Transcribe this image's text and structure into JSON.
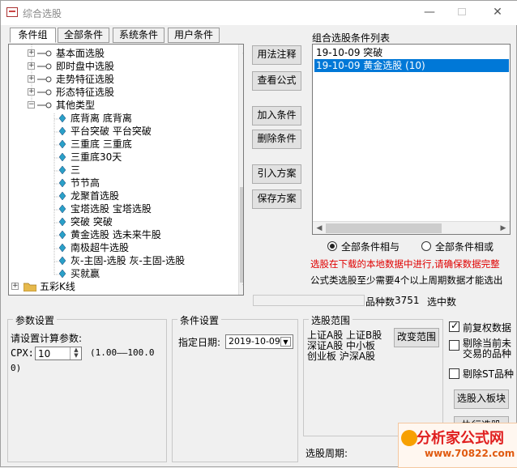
{
  "window": {
    "title": "综合选股"
  },
  "tabs": [
    {
      "label": "条件组"
    },
    {
      "label": "全部条件"
    },
    {
      "label": "系统条件"
    },
    {
      "label": "用户条件"
    }
  ],
  "tree": {
    "categories": [
      {
        "label": "基本面选股"
      },
      {
        "label": "即时盘中选股"
      },
      {
        "label": "走势特征选股"
      },
      {
        "label": "形态特征选股"
      },
      {
        "label": "其他类型"
      }
    ],
    "items": [
      {
        "label": "底背离 底背离"
      },
      {
        "label": "平台突破 平台突破"
      },
      {
        "label": "三重底 三重底"
      },
      {
        "label": "三重底30天"
      },
      {
        "label": "三"
      },
      {
        "label": "节节高"
      },
      {
        "label": "龙聚首选股"
      },
      {
        "label": "宝塔选股 宝塔选股"
      },
      {
        "label": "突破 突破"
      },
      {
        "label": "黄金选股 选未来牛股"
      },
      {
        "label": "南极超牛选股"
      },
      {
        "label": "灰-主固-选股 灰-主固-选股"
      },
      {
        "label": "买就赢"
      }
    ],
    "folder": {
      "label": "五彩K线"
    }
  },
  "buttons": {
    "usage": "用法注释",
    "view_formula": "查看公式",
    "add_condition": "加入条件",
    "delete_condition": "删除条件",
    "import_plan": "引入方案",
    "save_plan": "保存方案"
  },
  "condition_list": {
    "title": "组合选股条件列表",
    "items": [
      {
        "label": "19-10-09 突破"
      },
      {
        "label": "19-10-09 黄金选股 (10)"
      }
    ]
  },
  "logic": {
    "and_label": "全部条件相与",
    "or_label": "全部条件相或"
  },
  "notices": {
    "warning": "选股在下载的本地数据中进行,请确保数据完整",
    "info": "公式类选股至少需要4个以上周期数据才能选出"
  },
  "stats": {
    "count_label": "品种数",
    "count_value": "3751",
    "selected_label": "选中数",
    "selected_value": ""
  },
  "params": {
    "group_title": "参数设置",
    "prompt": "请设置计算参数:",
    "param_name": "CPX:",
    "param_value": "10",
    "param_range": "(1.00——100.0",
    "param_range_end": "0)"
  },
  "condition_settings": {
    "group_title": "条件设置",
    "date_label": "指定日期:",
    "date_value": "2019-10-09"
  },
  "range": {
    "group_title": "选股范围",
    "lines": [
      "上证A股 上证B股",
      "深证A股 中小板",
      "创业板 沪深A股"
    ],
    "change_button": "改变范围",
    "period_label": "选股周期:"
  },
  "options": {
    "prior_adjust": "前复权数据",
    "exclude_unlisted": "剔除当前未",
    "exclude_unlisted_line2": "交易的品种",
    "exclude_st": "剔除ST品种",
    "to_board_button": "选股入板块",
    "partial_button": "执行选股"
  },
  "watermark": {
    "main": "分析家公式网",
    "sub": "www.70822.com"
  },
  "colors": {
    "selection": "#0078d7",
    "warning_text": "#e00000",
    "leaf_icon": "#2aa0c8",
    "folder": "#e6b94c"
  }
}
